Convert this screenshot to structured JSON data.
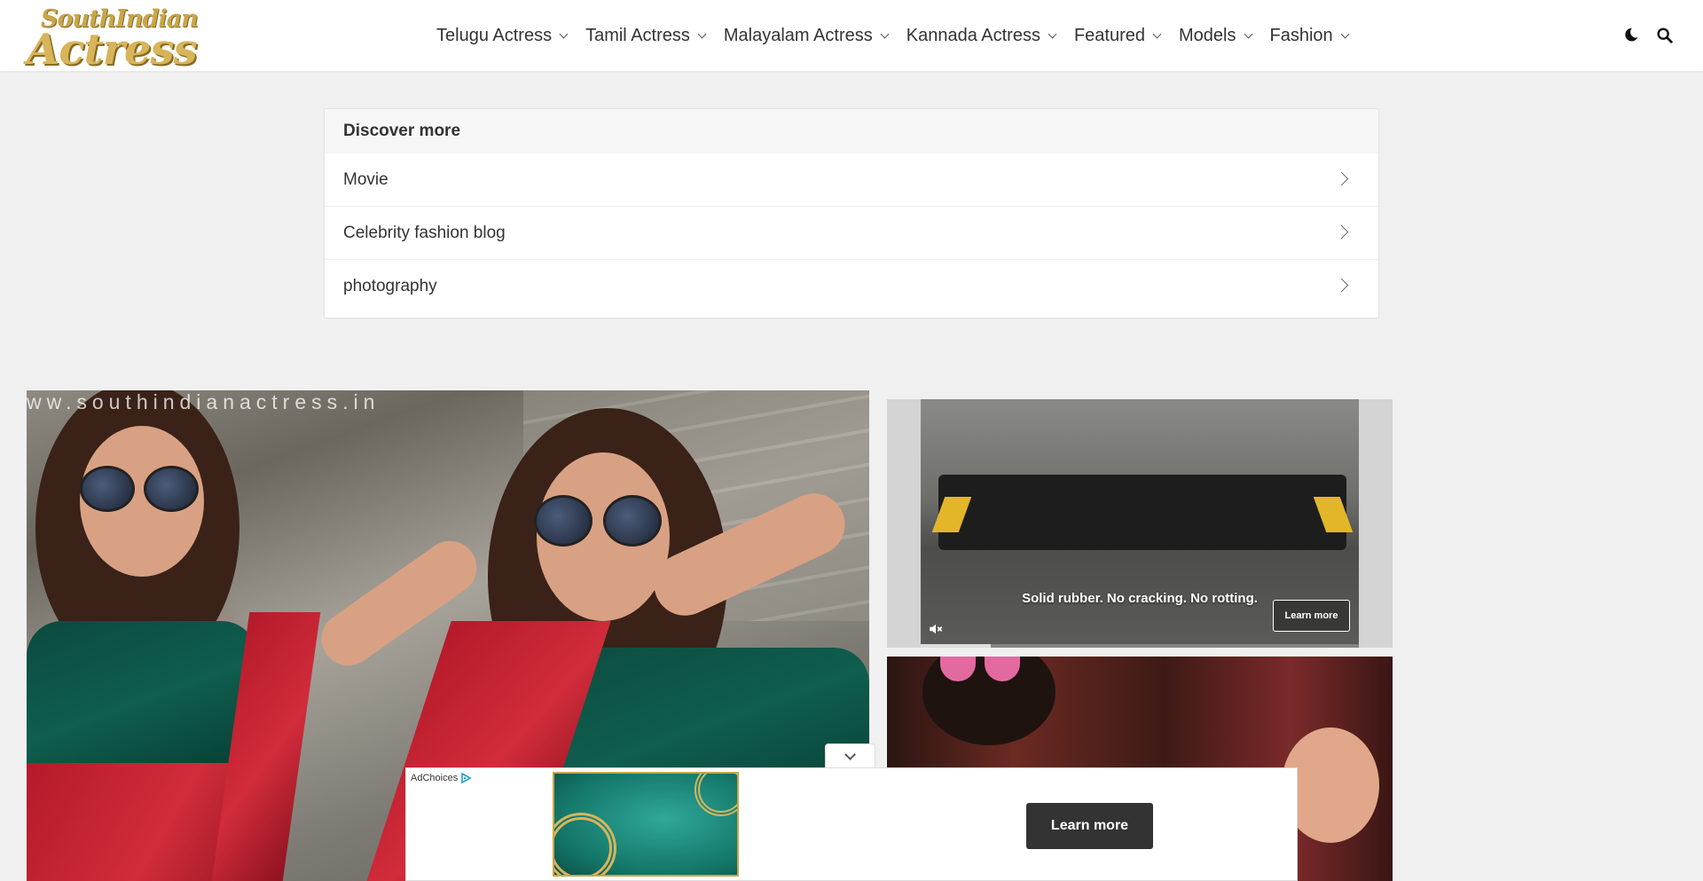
{
  "header": {
    "logo_line1": "SouthIndian",
    "logo_line2": "Actress",
    "nav": [
      {
        "label": "Telugu Actress"
      },
      {
        "label": "Tamil Actress"
      },
      {
        "label": "Malayalam Actress"
      },
      {
        "label": "Kannada Actress"
      },
      {
        "label": "Featured"
      },
      {
        "label": "Models"
      },
      {
        "label": "Fashion"
      }
    ],
    "icons": {
      "dark_mode": "moon-icon",
      "search": "search-icon"
    }
  },
  "discover": {
    "title": "Discover more",
    "items": [
      {
        "label": "Movie"
      },
      {
        "label": "Celebrity fashion blog"
      },
      {
        "label": "photography"
      }
    ]
  },
  "main_photo": {
    "watermark": "ww.southindianactress.in"
  },
  "video_ad": {
    "caption": "Solid rubber. No cracking. No rotting.",
    "learn_more": "Learn more",
    "progress": 0.16
  },
  "sticky_ad": {
    "adchoices": "AdChoices",
    "learn_more": "Learn more"
  }
}
